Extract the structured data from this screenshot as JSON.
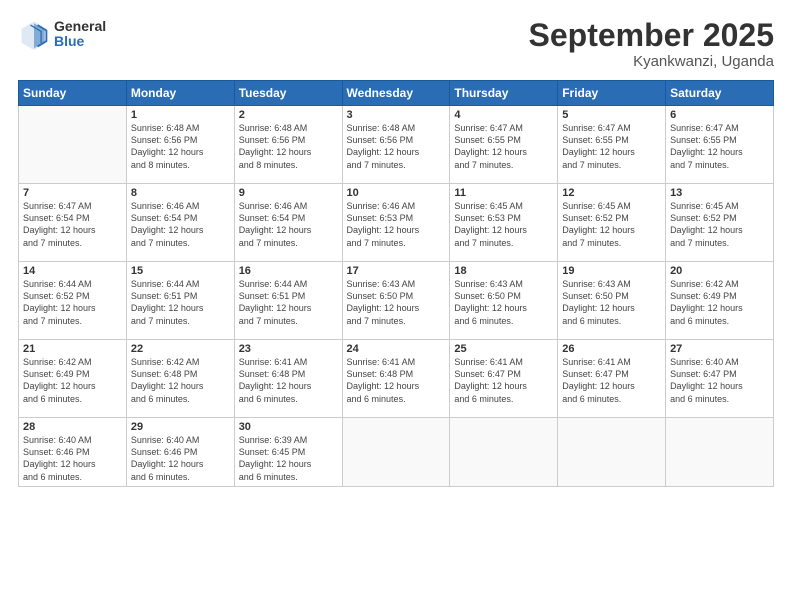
{
  "logo": {
    "general": "General",
    "blue": "Blue"
  },
  "title": "September 2025",
  "subtitle": "Kyankwanzi, Uganda",
  "days_header": [
    "Sunday",
    "Monday",
    "Tuesday",
    "Wednesday",
    "Thursday",
    "Friday",
    "Saturday"
  ],
  "weeks": [
    [
      {
        "day": "",
        "info": ""
      },
      {
        "day": "1",
        "info": "Sunrise: 6:48 AM\nSunset: 6:56 PM\nDaylight: 12 hours\nand 8 minutes."
      },
      {
        "day": "2",
        "info": "Sunrise: 6:48 AM\nSunset: 6:56 PM\nDaylight: 12 hours\nand 8 minutes."
      },
      {
        "day": "3",
        "info": "Sunrise: 6:48 AM\nSunset: 6:56 PM\nDaylight: 12 hours\nand 7 minutes."
      },
      {
        "day": "4",
        "info": "Sunrise: 6:47 AM\nSunset: 6:55 PM\nDaylight: 12 hours\nand 7 minutes."
      },
      {
        "day": "5",
        "info": "Sunrise: 6:47 AM\nSunset: 6:55 PM\nDaylight: 12 hours\nand 7 minutes."
      },
      {
        "day": "6",
        "info": "Sunrise: 6:47 AM\nSunset: 6:55 PM\nDaylight: 12 hours\nand 7 minutes."
      }
    ],
    [
      {
        "day": "7",
        "info": "Sunrise: 6:47 AM\nSunset: 6:54 PM\nDaylight: 12 hours\nand 7 minutes."
      },
      {
        "day": "8",
        "info": "Sunrise: 6:46 AM\nSunset: 6:54 PM\nDaylight: 12 hours\nand 7 minutes."
      },
      {
        "day": "9",
        "info": "Sunrise: 6:46 AM\nSunset: 6:54 PM\nDaylight: 12 hours\nand 7 minutes."
      },
      {
        "day": "10",
        "info": "Sunrise: 6:46 AM\nSunset: 6:53 PM\nDaylight: 12 hours\nand 7 minutes."
      },
      {
        "day": "11",
        "info": "Sunrise: 6:45 AM\nSunset: 6:53 PM\nDaylight: 12 hours\nand 7 minutes."
      },
      {
        "day": "12",
        "info": "Sunrise: 6:45 AM\nSunset: 6:52 PM\nDaylight: 12 hours\nand 7 minutes."
      },
      {
        "day": "13",
        "info": "Sunrise: 6:45 AM\nSunset: 6:52 PM\nDaylight: 12 hours\nand 7 minutes."
      }
    ],
    [
      {
        "day": "14",
        "info": "Sunrise: 6:44 AM\nSunset: 6:52 PM\nDaylight: 12 hours\nand 7 minutes."
      },
      {
        "day": "15",
        "info": "Sunrise: 6:44 AM\nSunset: 6:51 PM\nDaylight: 12 hours\nand 7 minutes."
      },
      {
        "day": "16",
        "info": "Sunrise: 6:44 AM\nSunset: 6:51 PM\nDaylight: 12 hours\nand 7 minutes."
      },
      {
        "day": "17",
        "info": "Sunrise: 6:43 AM\nSunset: 6:50 PM\nDaylight: 12 hours\nand 7 minutes."
      },
      {
        "day": "18",
        "info": "Sunrise: 6:43 AM\nSunset: 6:50 PM\nDaylight: 12 hours\nand 6 minutes."
      },
      {
        "day": "19",
        "info": "Sunrise: 6:43 AM\nSunset: 6:50 PM\nDaylight: 12 hours\nand 6 minutes."
      },
      {
        "day": "20",
        "info": "Sunrise: 6:42 AM\nSunset: 6:49 PM\nDaylight: 12 hours\nand 6 minutes."
      }
    ],
    [
      {
        "day": "21",
        "info": "Sunrise: 6:42 AM\nSunset: 6:49 PM\nDaylight: 12 hours\nand 6 minutes."
      },
      {
        "day": "22",
        "info": "Sunrise: 6:42 AM\nSunset: 6:48 PM\nDaylight: 12 hours\nand 6 minutes."
      },
      {
        "day": "23",
        "info": "Sunrise: 6:41 AM\nSunset: 6:48 PM\nDaylight: 12 hours\nand 6 minutes."
      },
      {
        "day": "24",
        "info": "Sunrise: 6:41 AM\nSunset: 6:48 PM\nDaylight: 12 hours\nand 6 minutes."
      },
      {
        "day": "25",
        "info": "Sunrise: 6:41 AM\nSunset: 6:47 PM\nDaylight: 12 hours\nand 6 minutes."
      },
      {
        "day": "26",
        "info": "Sunrise: 6:41 AM\nSunset: 6:47 PM\nDaylight: 12 hours\nand 6 minutes."
      },
      {
        "day": "27",
        "info": "Sunrise: 6:40 AM\nSunset: 6:47 PM\nDaylight: 12 hours\nand 6 minutes."
      }
    ],
    [
      {
        "day": "28",
        "info": "Sunrise: 6:40 AM\nSunset: 6:46 PM\nDaylight: 12 hours\nand 6 minutes."
      },
      {
        "day": "29",
        "info": "Sunrise: 6:40 AM\nSunset: 6:46 PM\nDaylight: 12 hours\nand 6 minutes."
      },
      {
        "day": "30",
        "info": "Sunrise: 6:39 AM\nSunset: 6:45 PM\nDaylight: 12 hours\nand 6 minutes."
      },
      {
        "day": "",
        "info": ""
      },
      {
        "day": "",
        "info": ""
      },
      {
        "day": "",
        "info": ""
      },
      {
        "day": "",
        "info": ""
      }
    ]
  ]
}
